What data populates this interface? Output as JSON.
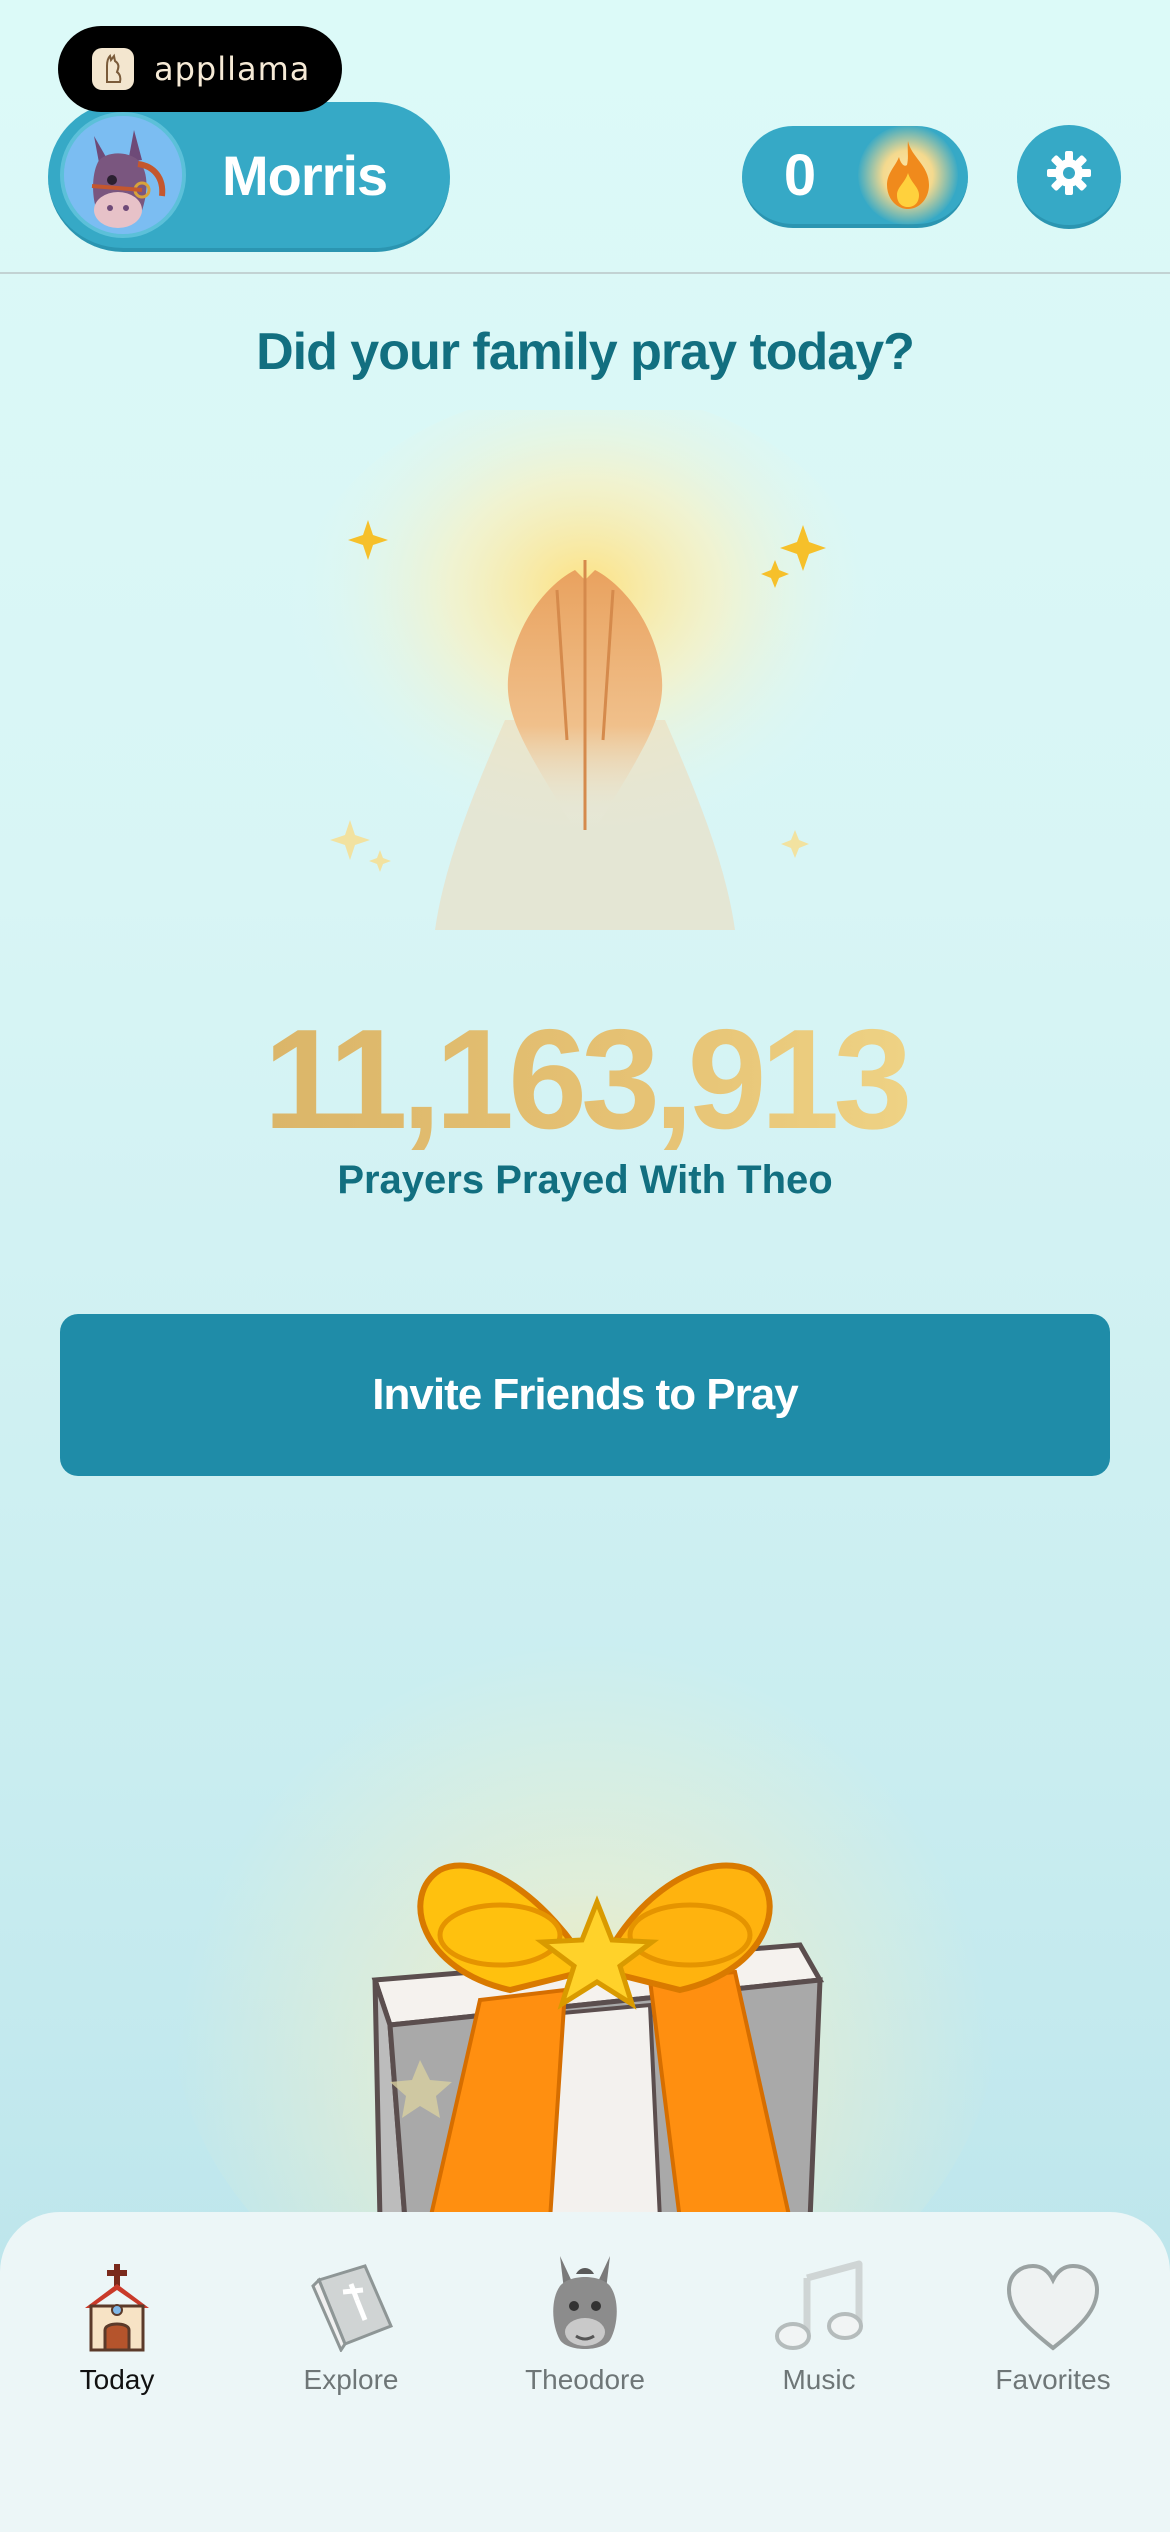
{
  "brand": {
    "name": "appllama"
  },
  "profile": {
    "name": "Morris"
  },
  "streak": {
    "count": "0"
  },
  "main": {
    "question": "Did your family pray today?",
    "prayer_count": "11,163,913",
    "prayer_caption": "Prayers Prayed With Theo",
    "invite_label": "Invite Friends to Pray"
  },
  "tabs": [
    {
      "label": "Today",
      "icon": "church-icon",
      "active": true
    },
    {
      "label": "Explore",
      "icon": "bible-icon",
      "active": false
    },
    {
      "label": "Theodore",
      "icon": "donkey-icon",
      "active": false
    },
    {
      "label": "Music",
      "icon": "music-note-icon",
      "active": false
    },
    {
      "label": "Favorites",
      "icon": "heart-icon",
      "active": false
    }
  ],
  "colors": {
    "accent": "#36a9c6",
    "button": "#1f8ca8",
    "heading": "#126f80",
    "counter_gold": "#d3ad61"
  }
}
